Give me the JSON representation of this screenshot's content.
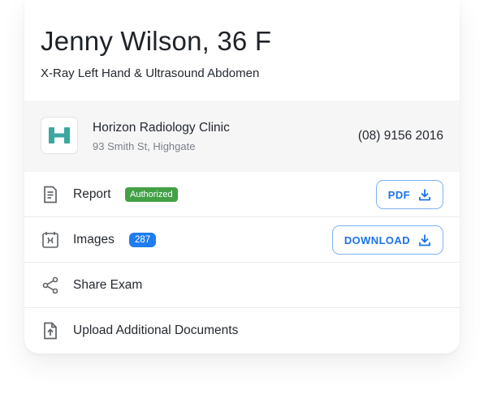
{
  "patient": {
    "name": "Jenny Wilson, 36 F",
    "exam": "X-Ray Left Hand & Ultrasound Abdomen"
  },
  "clinic": {
    "name": "Horizon Radiology Clinic",
    "address": "93 Smith St, Highgate",
    "phone": "(08) 9156 2016",
    "logo_color": "#3aa8a0"
  },
  "rows": [
    {
      "label": "Report",
      "badge": "Authorized",
      "badge_color": "#43a047",
      "action": "PDF",
      "icon": "document-icon"
    },
    {
      "label": "Images",
      "badge": "287",
      "badge_color": "#1e7df0",
      "action": "DOWNLOAD",
      "icon": "xray-image-icon"
    },
    {
      "label": "Share Exam",
      "icon": "share-icon"
    },
    {
      "label": "Upload Additional Documents",
      "icon": "upload-file-icon"
    }
  ],
  "colors": {
    "accent": "#1a73e8",
    "button_border": "#7fb2f0",
    "muted_text": "#7b8189"
  }
}
